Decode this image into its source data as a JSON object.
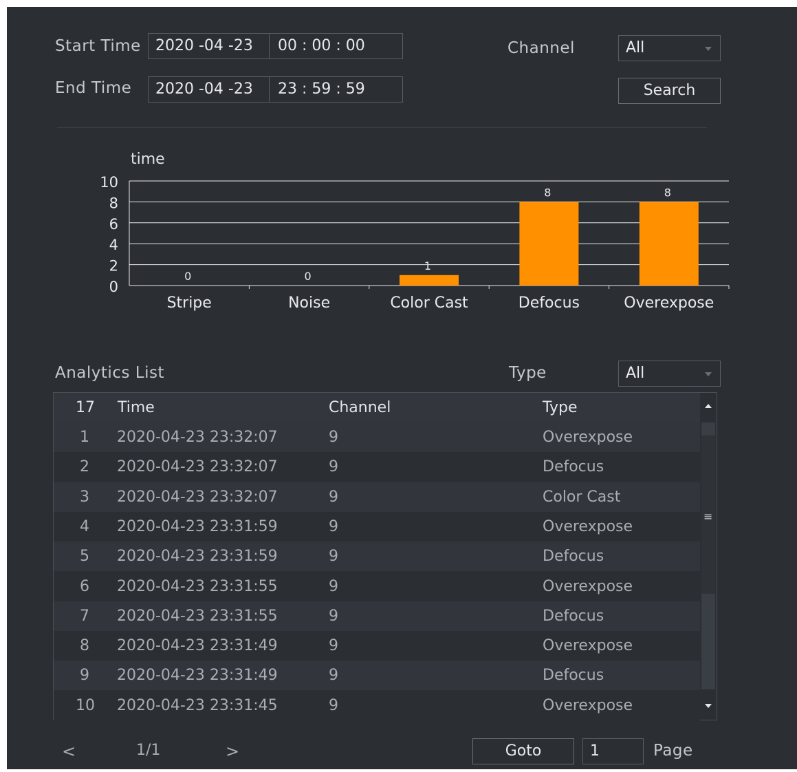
{
  "filters": {
    "start_label": "Start Time",
    "start_date": "2020 -04 -23",
    "start_time": "00 : 00 : 00",
    "end_label": "End Time",
    "end_date": "2020 -04 -23",
    "end_time": "23 : 59 : 59",
    "channel_label": "Channel",
    "channel_value": "All",
    "search_label": "Search"
  },
  "chart_data": {
    "type": "bar",
    "ylabel": "time",
    "categories": [
      "Stripe",
      "Noise",
      "Color Cast",
      "Defocus",
      "Overexpose"
    ],
    "values": [
      0,
      0,
      1,
      8,
      8
    ],
    "ylim": [
      0,
      10
    ],
    "yticks": [
      0,
      2,
      4,
      6,
      8,
      10
    ],
    "grid": true,
    "bar_color": "#ff9000"
  },
  "list": {
    "title": "Analytics List",
    "type_label": "Type",
    "type_value": "All",
    "columns": [
      "17",
      "Time",
      "Channel",
      "Type"
    ],
    "rows": [
      {
        "no": "1",
        "time": "2020-04-23 23:32:07",
        "channel": "9",
        "type": "Overexpose"
      },
      {
        "no": "2",
        "time": "2020-04-23 23:32:07",
        "channel": "9",
        "type": "Defocus"
      },
      {
        "no": "3",
        "time": "2020-04-23 23:32:07",
        "channel": "9",
        "type": "Color Cast"
      },
      {
        "no": "4",
        "time": "2020-04-23 23:31:59",
        "channel": "9",
        "type": "Overexpose"
      },
      {
        "no": "5",
        "time": "2020-04-23 23:31:59",
        "channel": "9",
        "type": "Defocus"
      },
      {
        "no": "6",
        "time": "2020-04-23 23:31:55",
        "channel": "9",
        "type": "Overexpose"
      },
      {
        "no": "7",
        "time": "2020-04-23 23:31:55",
        "channel": "9",
        "type": "Defocus"
      },
      {
        "no": "8",
        "time": "2020-04-23 23:31:49",
        "channel": "9",
        "type": "Overexpose"
      },
      {
        "no": "9",
        "time": "2020-04-23 23:31:49",
        "channel": "9",
        "type": "Defocus"
      },
      {
        "no": "10",
        "time": "2020-04-23 23:31:45",
        "channel": "9",
        "type": "Overexpose"
      }
    ]
  },
  "pager": {
    "prev": "<",
    "page_info": "1/1",
    "next": ">",
    "goto_label": "Goto",
    "goto_value": "1",
    "page_label": "Page"
  },
  "icons": {
    "scroll_up": "triangle-up-icon",
    "scroll_down": "triangle-down-icon",
    "grip": "≡"
  }
}
